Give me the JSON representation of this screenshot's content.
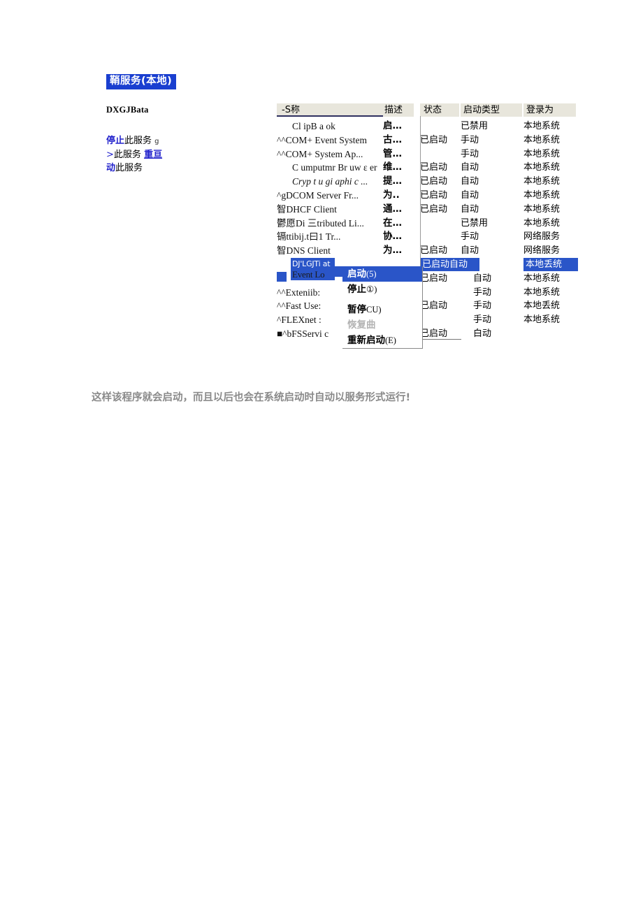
{
  "window": {
    "title": "鞘服务(本地)"
  },
  "left_pane": {
    "heading": "DXGJBata",
    "links": [
      {
        "main": "停止",
        "rest": "此服务",
        "tail": "g"
      },
      {
        "prefix": ">",
        "rest": "此服务",
        "underlined": "重亘"
      },
      {
        "main": "动",
        "rest": "此服务"
      }
    ]
  },
  "table": {
    "headers": {
      "name": "-S称",
      "description": "描述",
      "status": "状态",
      "startup_type": "启动类型",
      "log_on_as": "登录为"
    },
    "rows": [
      {
        "name": "Cl ipB a ok",
        "indent": true,
        "desc": "启…",
        "status": "",
        "startup": "已禁用",
        "logon": "本地系统"
      },
      {
        "name": "^^COM+ Event System",
        "indent": false,
        "desc": "古…",
        "status": "已启动",
        "startup": "手动",
        "logon": "本地系统"
      },
      {
        "name": "^^COM+ System Ap...",
        "indent": false,
        "desc": "管…",
        "status": "",
        "startup": "手动",
        "logon": "本地系统"
      },
      {
        "name": "C umputmr Br uw ε er",
        "indent": true,
        "desc": "维…",
        "status": "已启动",
        "startup": "自动",
        "logon": "本地系统"
      },
      {
        "name": "Cryp t u gi  aphi c ...",
        "indent": true,
        "italic": true,
        "desc": "提…",
        "status": "已启动",
        "startup": "自动",
        "logon": "本地系统"
      },
      {
        "name": "^gDCOM Server Fr...",
        "indent": false,
        "desc": "为..",
        "status": "已启动",
        "startup": "自动",
        "logon": "本地系统"
      },
      {
        "name": "智DHCF Client",
        "indent": false,
        "desc": "通…",
        "status": "已启动",
        "startup": "自动",
        "logon": "本地系统"
      },
      {
        "name": "鬱愿Di 三tributed Li...",
        "indent": false,
        "desc": "在…",
        "status": "",
        "startup": "已禁用",
        "logon": "本地系统"
      },
      {
        "name": "镉ttibij.t曰1 Tr...",
        "indent": false,
        "desc": "协…",
        "status": "",
        "startup": "手动",
        "logon": "网络服务"
      },
      {
        "name": "智DNS Client",
        "indent": false,
        "desc": "为…",
        "status": "已启动",
        "startup": "自动",
        "logon": "网络服务"
      },
      {
        "name": "DJ'LGJTi at",
        "selected": true,
        "name2": "Event    Lo",
        "desc": "",
        "status": "已启动",
        "startup": "自动",
        "logon": "本地丢统",
        "selected_status": true
      },
      {
        "name": "",
        "indent": false,
        "desc": "",
        "status": "已启动",
        "startup": "自动",
        "startup_indent": true,
        "logon": "本地系统"
      },
      {
        "name": "^^Exteniib:",
        "indent": false,
        "desc": "",
        "status": "",
        "startup": "手动",
        "startup_indent": true,
        "logon": "本地系统"
      },
      {
        "name": "^^Fast        Use:",
        "indent": false,
        "desc": "",
        "status": "已启动",
        "startup": "手动",
        "startup_indent": true,
        "logon": "本地丢统"
      },
      {
        "name": "^FLEXnet        :",
        "indent": false,
        "desc": "",
        "status": "",
        "startup": "手动",
        "startup_indent": true,
        "logon": "本地系统"
      },
      {
        "name": "■^bFSServi c",
        "indent": false,
        "desc": "",
        "status": "已启动",
        "startup": "白动",
        "startup_indent": true,
        "logon": ""
      }
    ]
  },
  "context_menu": {
    "items": [
      {
        "label": "启动",
        "suffix": "(5)",
        "state": "highlight"
      },
      {
        "label": "停止",
        "suffix": "①)",
        "state": "normal"
      },
      {
        "separator": true
      },
      {
        "label": "暂停",
        "suffix": "CU)",
        "state": "normal"
      },
      {
        "label": "恢复曲",
        "suffix": "",
        "state": "disabled"
      },
      {
        "label": "重新启动",
        "suffix": "(E)",
        "state": "normal"
      }
    ]
  },
  "caption": {
    "text": "这样该程序就会启动，而且以后也会在系统启动时自动以服务形式运行!"
  },
  "colors": {
    "selection_blue": "#2a55c8",
    "title_blue": "#1a3fd0",
    "link_blue": "#2222cc",
    "header_band": "#e8e6dc",
    "caption_gray": "#8a8a8a"
  }
}
